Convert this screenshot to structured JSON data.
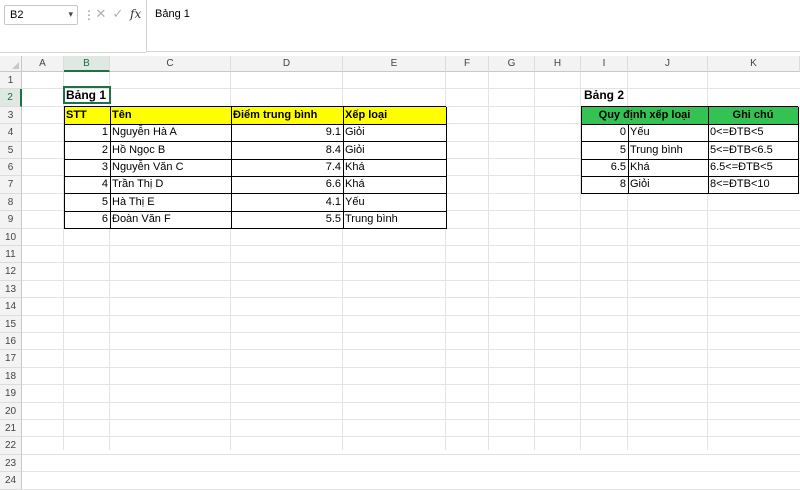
{
  "formula_bar": {
    "name_box": "B2",
    "separator": "⋮",
    "cancel_icon": "✕",
    "enter_icon": "✓",
    "fx_label": "fx",
    "content": "Bảng 1"
  },
  "columns": [
    "A",
    "B",
    "C",
    "D",
    "E",
    "F",
    "G",
    "H",
    "I",
    "J",
    "K"
  ],
  "selected_column": "B",
  "rows": [
    "1",
    "2",
    "3",
    "4",
    "5",
    "6",
    "7",
    "8",
    "9",
    "10",
    "11",
    "12",
    "13",
    "14",
    "15",
    "16",
    "17",
    "18",
    "19",
    "20",
    "21",
    "22",
    "23",
    "24"
  ],
  "selected_row": "2",
  "table1": {
    "title": "Bảng 1",
    "headers": [
      "STT",
      "Tên",
      "Điểm trung bình",
      "Xếp loại"
    ],
    "rows": [
      [
        "1",
        "Nguyễn Hà A",
        "9.1",
        "Giỏi"
      ],
      [
        "2",
        "Hồ Ngọc B",
        "8.4",
        "Giỏi"
      ],
      [
        "3",
        "Nguyễn Văn C",
        "7.4",
        "Khá"
      ],
      [
        "4",
        "Trần Thị D",
        "6.6",
        "Khá"
      ],
      [
        "5",
        "Hà Thị E",
        "4.1",
        "Yếu"
      ],
      [
        "6",
        "Đoàn Văn F",
        "5.5",
        "Trung bình"
      ]
    ],
    "header_color": "#ffff00"
  },
  "table2": {
    "title": "Bảng 2",
    "headers": [
      "Quy định xếp loại",
      "Ghi chú"
    ],
    "rows": [
      [
        "0",
        "Yếu",
        "0<=ĐTB<5"
      ],
      [
        "5",
        "Trung bình",
        "5<=ĐTB<6.5"
      ],
      [
        "6.5",
        "Khá",
        "6.5<=ĐTB<5"
      ],
      [
        "8",
        "Giỏi",
        "8<=ĐTB<10"
      ]
    ],
    "header_color": "#34c353"
  },
  "accent_color": "#1e7145"
}
